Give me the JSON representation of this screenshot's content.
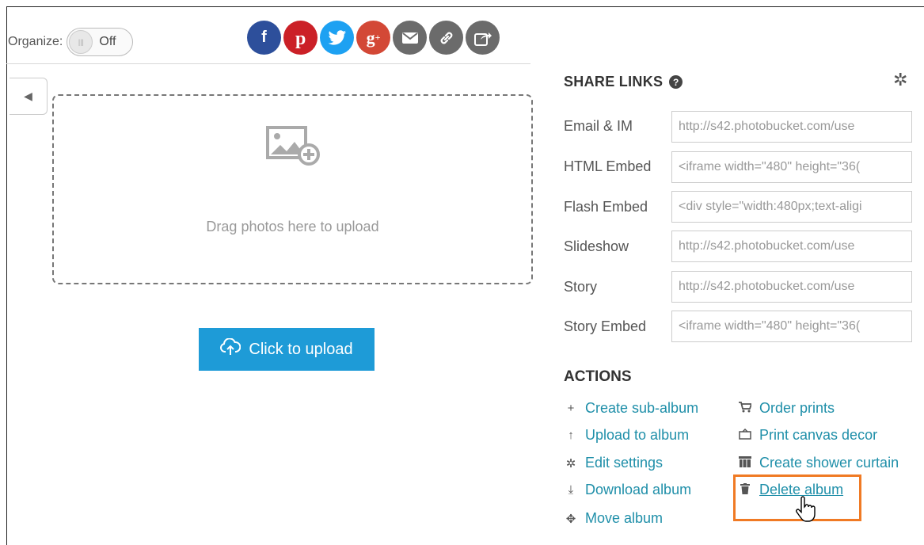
{
  "organize": {
    "label": "Organize:",
    "toggle_state": "Off"
  },
  "social": [
    {
      "name": "facebook-icon",
      "glyph": "f",
      "color": "#2d4f9b"
    },
    {
      "name": "pinterest-icon",
      "glyph": "P",
      "color": "#cb2027"
    },
    {
      "name": "twitter-icon",
      "glyph": "t",
      "color": "#1da1f2"
    },
    {
      "name": "google-plus-icon",
      "glyph": "g+",
      "color": "#d34836"
    },
    {
      "name": "email-icon",
      "glyph": "✉",
      "color": "#6b6b6b"
    },
    {
      "name": "link-icon",
      "glyph": "🔗",
      "color": "#6b6b6b"
    },
    {
      "name": "share-icon",
      "glyph": "↗",
      "color": "#6b6b6b"
    }
  ],
  "upload": {
    "dropzone_text": "Drag photos here to upload",
    "button_label": "Click to upload"
  },
  "share_links": {
    "title": "SHARE LINKS",
    "rows": [
      {
        "label": "Email & IM",
        "value": "http://s42.photobucket.com/use"
      },
      {
        "label": "HTML Embed",
        "value": "<iframe width=\"480\" height=\"36("
      },
      {
        "label": "Flash Embed",
        "value": "<div style=\"width:480px;text-aligi"
      },
      {
        "label": "Slideshow",
        "value": "http://s42.photobucket.com/use"
      },
      {
        "label": "Story",
        "value": "http://s42.photobucket.com/use"
      },
      {
        "label": "Story Embed",
        "value": "<iframe width=\"480\" height=\"36("
      }
    ]
  },
  "actions": {
    "title": "ACTIONS",
    "left": [
      {
        "label": "Create sub-album",
        "icon": "plus-icon"
      },
      {
        "label": "Upload to album",
        "icon": "arrow-up-icon"
      },
      {
        "label": "Edit settings",
        "icon": "gear-icon"
      },
      {
        "label": "Download album",
        "icon": "download-icon"
      },
      {
        "label": "Move album",
        "icon": "move-icon"
      }
    ],
    "right": [
      {
        "label": "Order prints",
        "icon": "cart-icon"
      },
      {
        "label": "Print canvas decor",
        "icon": "canvas-icon"
      },
      {
        "label": "Create shower curtain",
        "icon": "curtain-icon"
      },
      {
        "label": "Delete album",
        "icon": "trash-icon"
      }
    ]
  },
  "colors": {
    "accent": "#1e9bd7",
    "link": "#1f8fa9",
    "highlight": "#f07a24"
  }
}
